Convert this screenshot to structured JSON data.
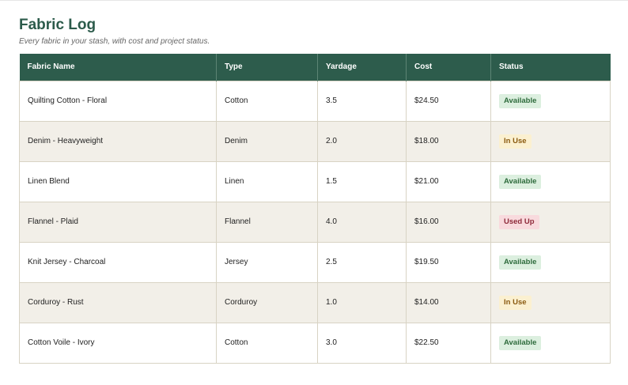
{
  "header": {
    "title": "Fabric Log",
    "subtitle": "Every fabric in your stash, with cost and project status."
  },
  "table": {
    "columns": [
      "Fabric Name",
      "Type",
      "Yardage",
      "Cost",
      "Status"
    ],
    "rows": [
      {
        "name": "Quilting Cotton - Floral",
        "type": "Cotton",
        "yardage": "3.5",
        "cost": "$24.50",
        "status": "Available",
        "status_key": "available"
      },
      {
        "name": "Denim - Heavyweight",
        "type": "Denim",
        "yardage": "2.0",
        "cost": "$18.00",
        "status": "In Use",
        "status_key": "in-use"
      },
      {
        "name": "Linen Blend",
        "type": "Linen",
        "yardage": "1.5",
        "cost": "$21.00",
        "status": "Available",
        "status_key": "available"
      },
      {
        "name": "Flannel - Plaid",
        "type": "Flannel",
        "yardage": "4.0",
        "cost": "$16.00",
        "status": "Used Up",
        "status_key": "used-up"
      },
      {
        "name": "Knit Jersey - Charcoal",
        "type": "Jersey",
        "yardage": "2.5",
        "cost": "$19.50",
        "status": "Available",
        "status_key": "available"
      },
      {
        "name": "Corduroy - Rust",
        "type": "Corduroy",
        "yardage": "1.0",
        "cost": "$14.00",
        "status": "In Use",
        "status_key": "in-use"
      },
      {
        "name": "Cotton Voile - Ivory",
        "type": "Cotton",
        "yardage": "3.0",
        "cost": "$22.50",
        "status": "Available",
        "status_key": "available"
      }
    ]
  },
  "colors": {
    "accent": "#2d5c4c",
    "available_bg": "#dcefdf",
    "in_use_bg": "#fbf0d0",
    "used_up_bg": "#f8dadd"
  }
}
